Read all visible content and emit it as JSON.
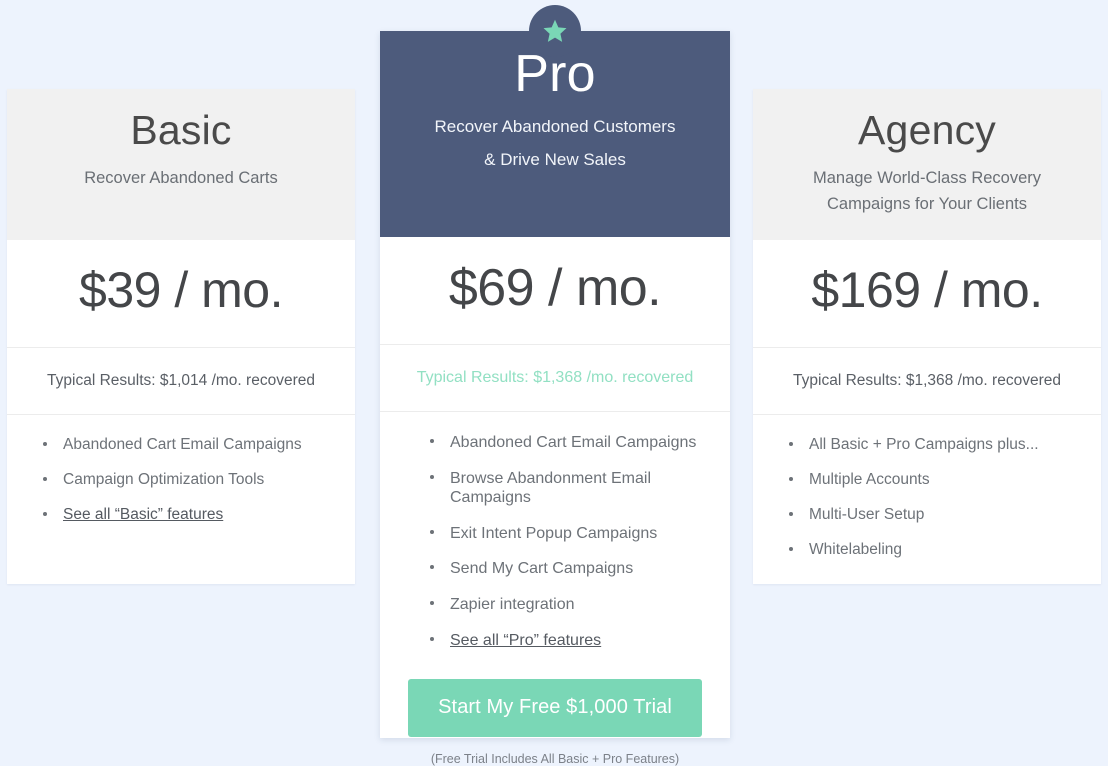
{
  "plans": [
    {
      "id": "basic",
      "name": "Basic",
      "tagline": "Recover Abandoned Carts",
      "price": "$39 / mo.",
      "results": "Typical Results: $1,014 /mo. recovered",
      "features": [
        {
          "label": "Abandoned Cart Email Campaigns",
          "is_link": false
        },
        {
          "label": "Campaign Optimization Tools",
          "is_link": false
        },
        {
          "label": "See all “Basic” features",
          "is_link": true
        }
      ]
    },
    {
      "id": "pro",
      "name": "Pro",
      "tagline": "Recover Abandoned Customers & Drive New Sales",
      "tagline_line1": "Recover Abandoned Customers",
      "tagline_line2": "& Drive New Sales",
      "price": "$69 / mo.",
      "results": "Typical Results: $1,368 /mo. recovered",
      "badge_icon": "star-icon",
      "features": [
        {
          "label": "Abandoned Cart Email Campaigns",
          "is_link": false
        },
        {
          "label": "Browse Abandonment Email Campaigns",
          "is_link": false
        },
        {
          "label": "Exit Intent Popup Campaigns",
          "is_link": false
        },
        {
          "label": "Send My Cart Campaigns",
          "is_link": false
        },
        {
          "label": "Zapier integration",
          "is_link": false
        },
        {
          "label": "See all “Pro” features",
          "is_link": true
        }
      ],
      "cta_label": "Start My Free $1,000 Trial",
      "cta_note": "(Free Trial Includes All Basic + Pro Features)"
    },
    {
      "id": "agency",
      "name": "Agency",
      "tagline": "Manage World-Class Recovery Campaigns for Your Clients",
      "tagline_line1": "Manage World-Class Recovery",
      "tagline_line2": "Campaigns for Your Clients",
      "price": "$169 / mo.",
      "results": "Typical Results: $1,368 /mo. recovered",
      "features": [
        {
          "label": "All Basic + Pro Campaigns plus...",
          "is_link": false
        },
        {
          "label": "Multiple Accounts",
          "is_link": false
        },
        {
          "label": "Multi-User Setup",
          "is_link": false
        },
        {
          "label": "Whitelabeling",
          "is_link": false
        }
      ]
    }
  ],
  "colors": {
    "page_background": "#edf3fd",
    "featured_header": "#4d5b7c",
    "side_header": "#f1f1f1",
    "accent_green": "#7ad7b6",
    "results_green": "#92e0c3",
    "card_white": "#ffffff",
    "text_dark": "#4a4a4a",
    "text_muted": "#6d7278"
  }
}
